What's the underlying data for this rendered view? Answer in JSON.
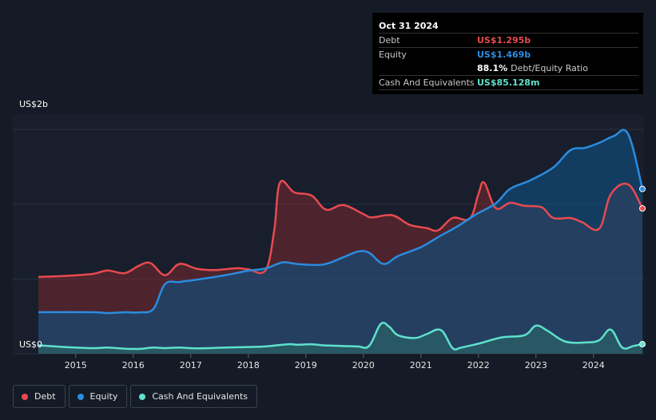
{
  "chart_data": {
    "type": "area",
    "ylim": [
      0,
      2000
    ],
    "y_tick_labels": [
      "US$0",
      "US$2b"
    ],
    "x_tick_labels": [
      "2015",
      "2016",
      "2017",
      "2018",
      "2019",
      "2020",
      "2021",
      "2022",
      "2023",
      "2024"
    ],
    "xlim": [
      2014.35,
      2024.85
    ],
    "series": [
      {
        "name": "Debt",
        "color": "#e84a50",
        "x": [
          2014.35,
          2014.8,
          2015.3,
          2015.55,
          2015.85,
          2016.1,
          2016.3,
          2016.55,
          2016.8,
          2017.1,
          2017.4,
          2017.8,
          2018.0,
          2018.3,
          2018.45,
          2018.55,
          2018.8,
          2019.1,
          2019.35,
          2019.65,
          2020.0,
          2020.15,
          2020.5,
          2020.8,
          2021.1,
          2021.3,
          2021.55,
          2021.85,
          2022.0,
          2022.1,
          2022.3,
          2022.55,
          2022.8,
          2023.1,
          2023.3,
          2023.6,
          2023.8,
          2024.1,
          2024.3,
          2024.6,
          2024.85
        ],
        "values": [
          685,
          693,
          712,
          742,
          718,
          785,
          808,
          700,
          800,
          758,
          745,
          762,
          752,
          745,
          1100,
          1525,
          1438,
          1410,
          1285,
          1325,
          1245,
          1215,
          1235,
          1150,
          1120,
          1100,
          1210,
          1205,
          1425,
          1525,
          1298,
          1345,
          1318,
          1305,
          1210,
          1210,
          1172,
          1115,
          1420,
          1510,
          1295
        ]
      },
      {
        "name": "Equity",
        "color": "#2b8cdf",
        "x": [
          2014.35,
          2015.3,
          2015.55,
          2015.85,
          2016.1,
          2016.35,
          2016.55,
          2016.8,
          2017.1,
          2017.6,
          2018.0,
          2018.3,
          2018.6,
          2018.85,
          2019.3,
          2019.65,
          2019.9,
          2020.1,
          2020.35,
          2020.6,
          2021.0,
          2021.3,
          2021.65,
          2021.95,
          2022.3,
          2022.55,
          2022.9,
          2023.3,
          2023.6,
          2023.85,
          2024.1,
          2024.35,
          2024.6,
          2024.85
        ],
        "values": [
          370,
          370,
          362,
          370,
          368,
          400,
          620,
          640,
          660,
          700,
          740,
          760,
          815,
          800,
          795,
          860,
          910,
          900,
          800,
          870,
          950,
          1040,
          1140,
          1240,
          1340,
          1470,
          1545,
          1660,
          1815,
          1835,
          1880,
          1940,
          1960,
          1469
        ]
      },
      {
        "name": "Cash And Equivalents",
        "color": "#5ee1cc",
        "x": [
          2014.35,
          2014.8,
          2015.3,
          2015.55,
          2015.85,
          2016.1,
          2016.35,
          2016.55,
          2016.8,
          2017.1,
          2017.6,
          2018.0,
          2018.3,
          2018.7,
          2018.85,
          2019.1,
          2019.3,
          2019.6,
          2019.9,
          2020.1,
          2020.3,
          2020.45,
          2020.6,
          2020.9,
          2021.1,
          2021.35,
          2021.55,
          2021.7,
          2022.0,
          2022.4,
          2022.8,
          2023.0,
          2023.2,
          2023.5,
          2023.85,
          2024.1,
          2024.3,
          2024.5,
          2024.7,
          2024.85
        ],
        "values": [
          75,
          60,
          50,
          55,
          45,
          43,
          55,
          50,
          55,
          48,
          55,
          60,
          65,
          85,
          80,
          85,
          75,
          70,
          65,
          70,
          265,
          240,
          165,
          140,
          175,
          210,
          50,
          55,
          90,
          145,
          165,
          250,
          205,
          110,
          100,
          120,
          215,
          55,
          70,
          85
        ]
      }
    ]
  },
  "tooltip": {
    "date": "Oct 31 2024",
    "rows": [
      {
        "label": "Debt",
        "value": "US$1.295b",
        "color": "#e84a50"
      },
      {
        "label": "Equity",
        "value": "US$1.469b",
        "color": "#2b8cdf"
      },
      {
        "label": "",
        "value": "88.1%",
        "suffix": "Debt/Equity Ratio",
        "color": "#ffffff"
      },
      {
        "label": "Cash And Equivalents",
        "value": "US$85.128m",
        "color": "#5ee1cc"
      }
    ]
  },
  "legend": [
    {
      "label": "Debt",
      "color": "#e84a50"
    },
    {
      "label": "Equity",
      "color": "#2b8cdf"
    },
    {
      "label": "Cash And Equivalents",
      "color": "#5ee1cc"
    }
  ]
}
